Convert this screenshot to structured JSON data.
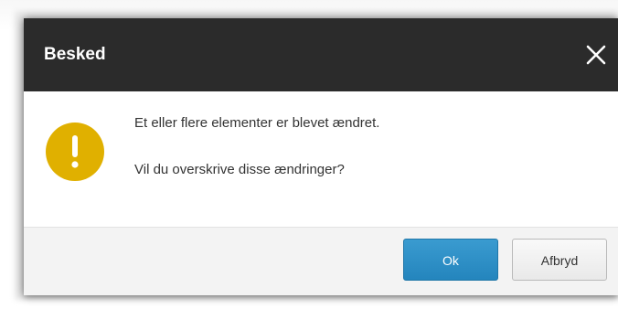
{
  "dialog": {
    "title": "Besked",
    "close_icon": "close-icon",
    "warning_icon": "exclamation-circle-icon",
    "message_line1": "Et eller flere elementer er blevet ændret.",
    "message_line2": "Vil du overskrive disse ændringer?",
    "ok_label": "Ok",
    "cancel_label": "Afbryd"
  },
  "colors": {
    "titlebar": "#2b2b2b",
    "warning": "#e0b000",
    "primary_button": "#2e8fc7",
    "footer": "#f3f3f3"
  }
}
